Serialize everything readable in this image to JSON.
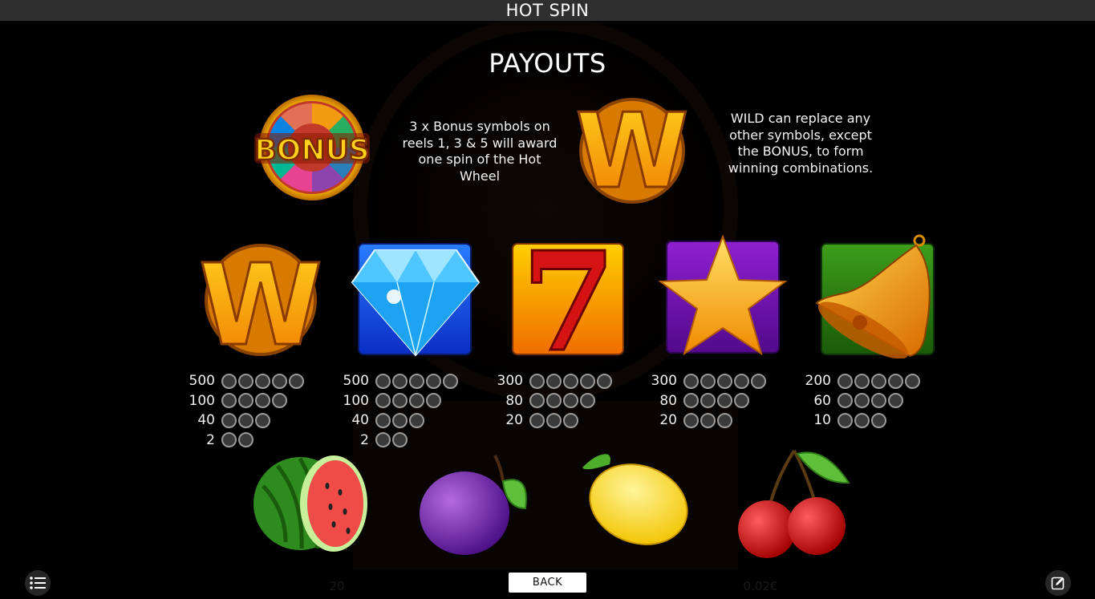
{
  "window": {
    "title": "HOT SPIN"
  },
  "page": {
    "title": "PAYOUTS"
  },
  "special_symbols": [
    {
      "name": "BONUS",
      "badge_text": "BONUS",
      "description": "3 x Bonus symbols on reels 1, 3 & 5 will award one spin of the Hot Wheel"
    },
    {
      "name": "WILD",
      "badge_text": "W",
      "description": "WILD can replace any other symbols, except the BONUS, to form winning combinations."
    }
  ],
  "pay_symbols": [
    {
      "icon": "wild-w",
      "label_w": "W",
      "payouts": [
        {
          "value": "500",
          "count": 5
        },
        {
          "value": "100",
          "count": 4
        },
        {
          "value": "40",
          "count": 3
        },
        {
          "value": "2",
          "count": 2
        }
      ]
    },
    {
      "icon": "diamond",
      "payouts": [
        {
          "value": "500",
          "count": 5
        },
        {
          "value": "100",
          "count": 4
        },
        {
          "value": "40",
          "count": 3
        },
        {
          "value": "2",
          "count": 2
        }
      ]
    },
    {
      "icon": "seven",
      "label_7": "7",
      "payouts": [
        {
          "value": "300",
          "count": 5
        },
        {
          "value": "80",
          "count": 4
        },
        {
          "value": "20",
          "count": 3
        }
      ]
    },
    {
      "icon": "star",
      "payouts": [
        {
          "value": "300",
          "count": 5
        },
        {
          "value": "80",
          "count": 4
        },
        {
          "value": "20",
          "count": 3
        }
      ]
    },
    {
      "icon": "bell",
      "payouts": [
        {
          "value": "200",
          "count": 5
        },
        {
          "value": "60",
          "count": 4
        },
        {
          "value": "10",
          "count": 3
        }
      ]
    }
  ],
  "fruit_symbols": [
    "watermelon",
    "plum",
    "lemon",
    "cherries"
  ],
  "buttons": {
    "back": "BACK"
  },
  "bottom_bar": {
    "lines_value": "20",
    "bet_value": "0.02€"
  },
  "colors": {
    "titlebar": "#2f2f2f",
    "background": "#000000",
    "gold": "#f5a800",
    "dot_border": "#9a9a9a"
  }
}
